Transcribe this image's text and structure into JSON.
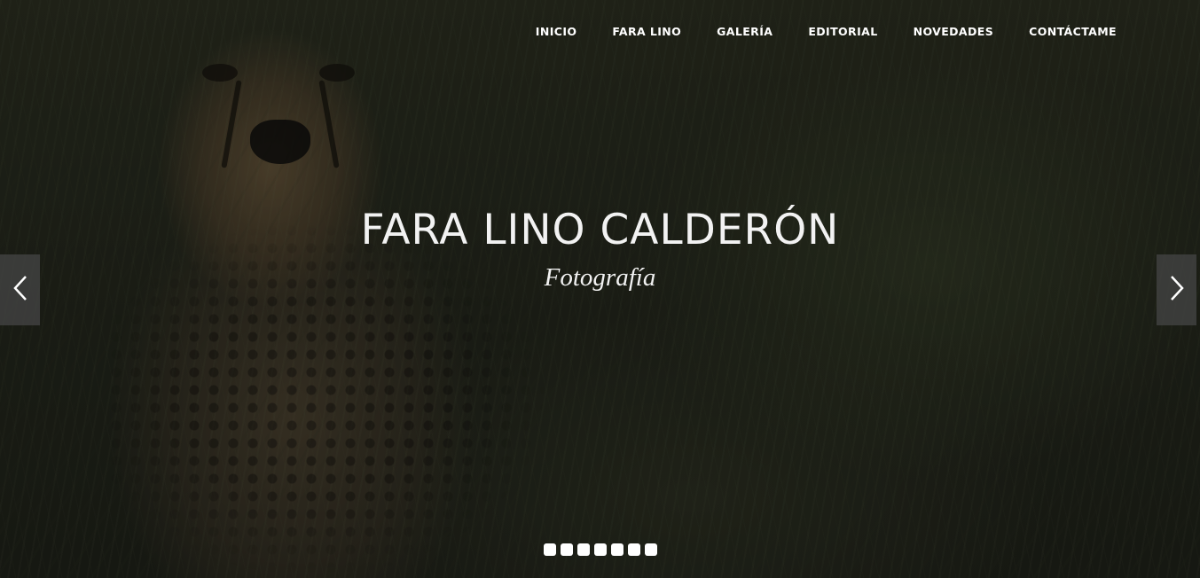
{
  "nav": {
    "items": [
      {
        "label": "INICIO"
      },
      {
        "label": "FARA LINO"
      },
      {
        "label": "GALERÍA"
      },
      {
        "label": "EDITORIAL"
      },
      {
        "label": "NOVEDADES"
      },
      {
        "label": "CONTÁCTAME"
      }
    ]
  },
  "hero": {
    "title": "FARA LINO CALDERÓN",
    "subtitle": "Fotografía",
    "background_image": "cheetah-in-grass-photo"
  },
  "slider": {
    "prev_icon": "chevron-left-icon",
    "next_icon": "chevron-right-icon",
    "slide_count": 7
  },
  "colors": {
    "text": "#ffffff",
    "arrow_bg": "#464646"
  }
}
